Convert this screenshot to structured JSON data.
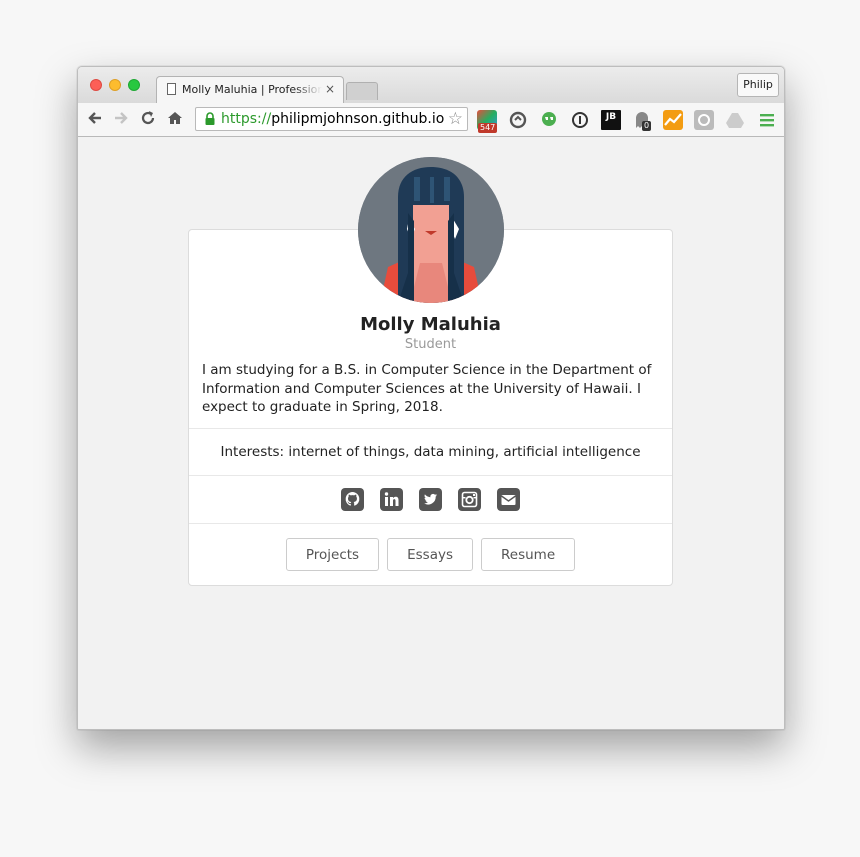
{
  "browser": {
    "tab_title": "Molly Maluhia | Professional Portfolio",
    "tab_close": "×",
    "profile_name": "Philip",
    "url_scheme": "https://",
    "url_host": "philipmjohnson.github.io",
    "extensions": [
      {
        "name": "extension-icon-1",
        "badge": "547"
      },
      {
        "name": "extension-icon-2"
      },
      {
        "name": "extension-icon-3"
      },
      {
        "name": "extension-icon-4"
      },
      {
        "name": "jetbrains-icon",
        "text": "JB"
      },
      {
        "name": "ghostery-icon",
        "badge": "0"
      },
      {
        "name": "analytics-icon"
      },
      {
        "name": "extension-icon-8"
      },
      {
        "name": "google-drive-icon"
      },
      {
        "name": "chrome-menu-icon"
      }
    ]
  },
  "profile": {
    "name": "Molly Maluhia",
    "role": "Student",
    "bio": "I am studying for a B.S. in Computer Science in the Department of Information and Computer Sciences at the University of Hawaii. I expect to graduate in Spring, 2018.",
    "interests": "Interests: internet of things, data mining, artificial intelligence"
  },
  "social_links": [
    "github-icon",
    "linkedin-icon",
    "twitter-icon",
    "instagram-icon",
    "email-icon"
  ],
  "buttons": {
    "projects": "Projects",
    "essays": "Essays",
    "resume": "Resume"
  }
}
